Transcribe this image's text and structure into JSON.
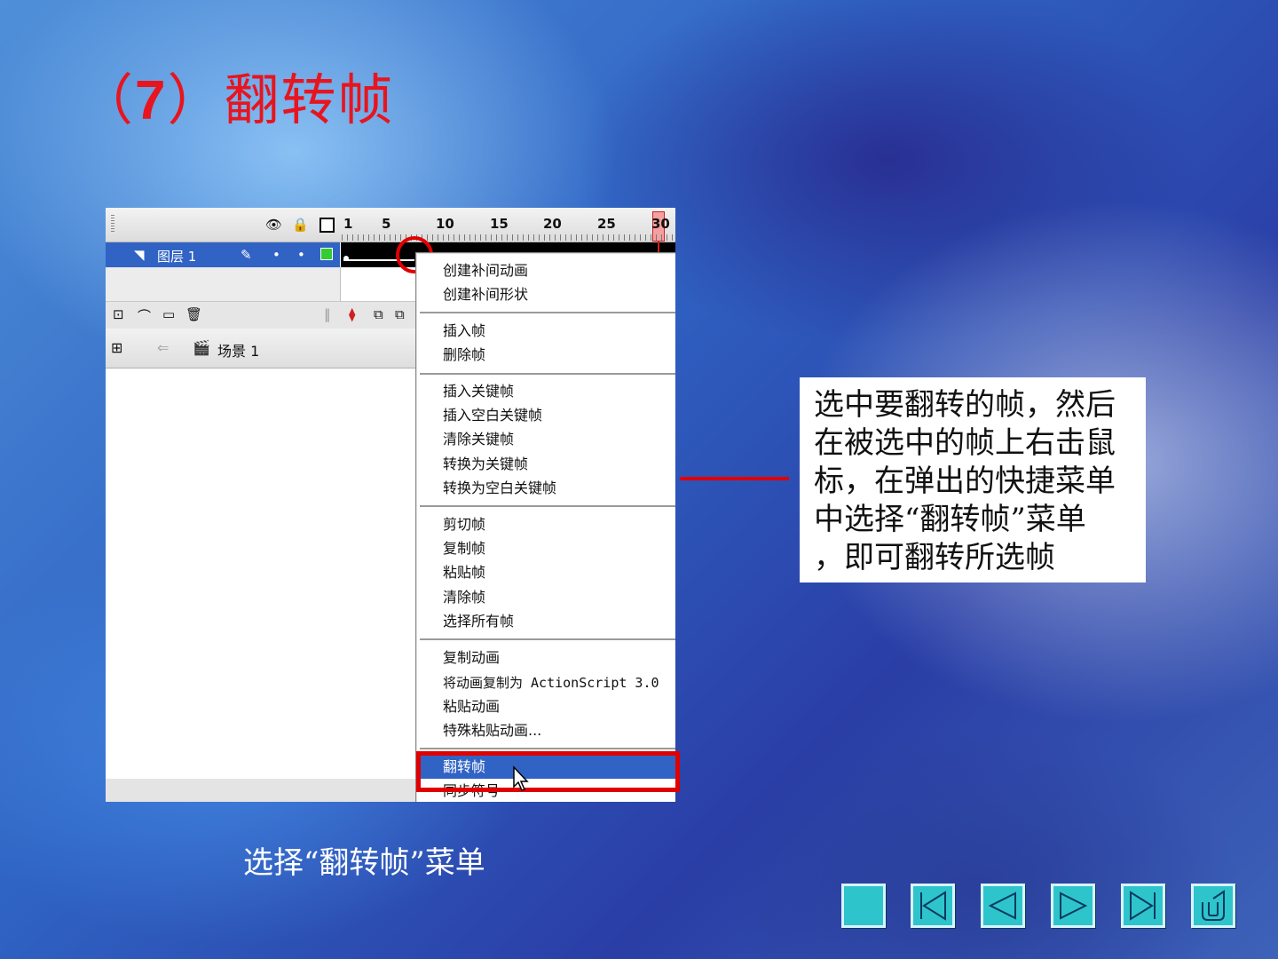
{
  "slide": {
    "title_prefix": "（",
    "title_number": "7",
    "title_suffix": "）翻转帧",
    "caption": "选择“翻转帧”菜单",
    "callout_lines": [
      "选中要翻转的帧，然后",
      "在被选中的帧上右击鼠",
      "标，在弹出的快捷菜单",
      "中选择“翻转帧”菜单",
      "，即可翻转所选帧"
    ]
  },
  "timeline": {
    "ruler_labels": [
      "1",
      "5",
      "10",
      "15",
      "20",
      "25",
      "30"
    ],
    "layer_name": "图层 1",
    "scene_name": "场景 1",
    "current_frame": 30
  },
  "context_menu": {
    "groups": [
      [
        "创建补间动画",
        "创建补间形状"
      ],
      [
        "插入帧",
        "删除帧"
      ],
      [
        "插入关键帧",
        "插入空白关键帧",
        "清除关键帧",
        "转换为关键帧",
        "转换为空白关键帧"
      ],
      [
        "剪切帧",
        "复制帧",
        "粘贴帧",
        "清除帧",
        "选择所有帧"
      ],
      [
        "复制动画",
        "将动画复制为 ActionScript 3.0",
        "粘贴动画",
        "特殊粘贴动画..."
      ],
      [
        "翻转帧",
        "同步符号"
      ]
    ],
    "highlighted": "翻转帧"
  },
  "nav": {
    "buttons": [
      "home-button",
      "first-slide-button",
      "previous-slide-button",
      "next-slide-button",
      "last-slide-button",
      "return-button"
    ],
    "color": "#2ec4cc"
  },
  "colors": {
    "accent_red": "#e00000",
    "title_red": "#e8141e",
    "selection_blue": "#3163c5"
  }
}
